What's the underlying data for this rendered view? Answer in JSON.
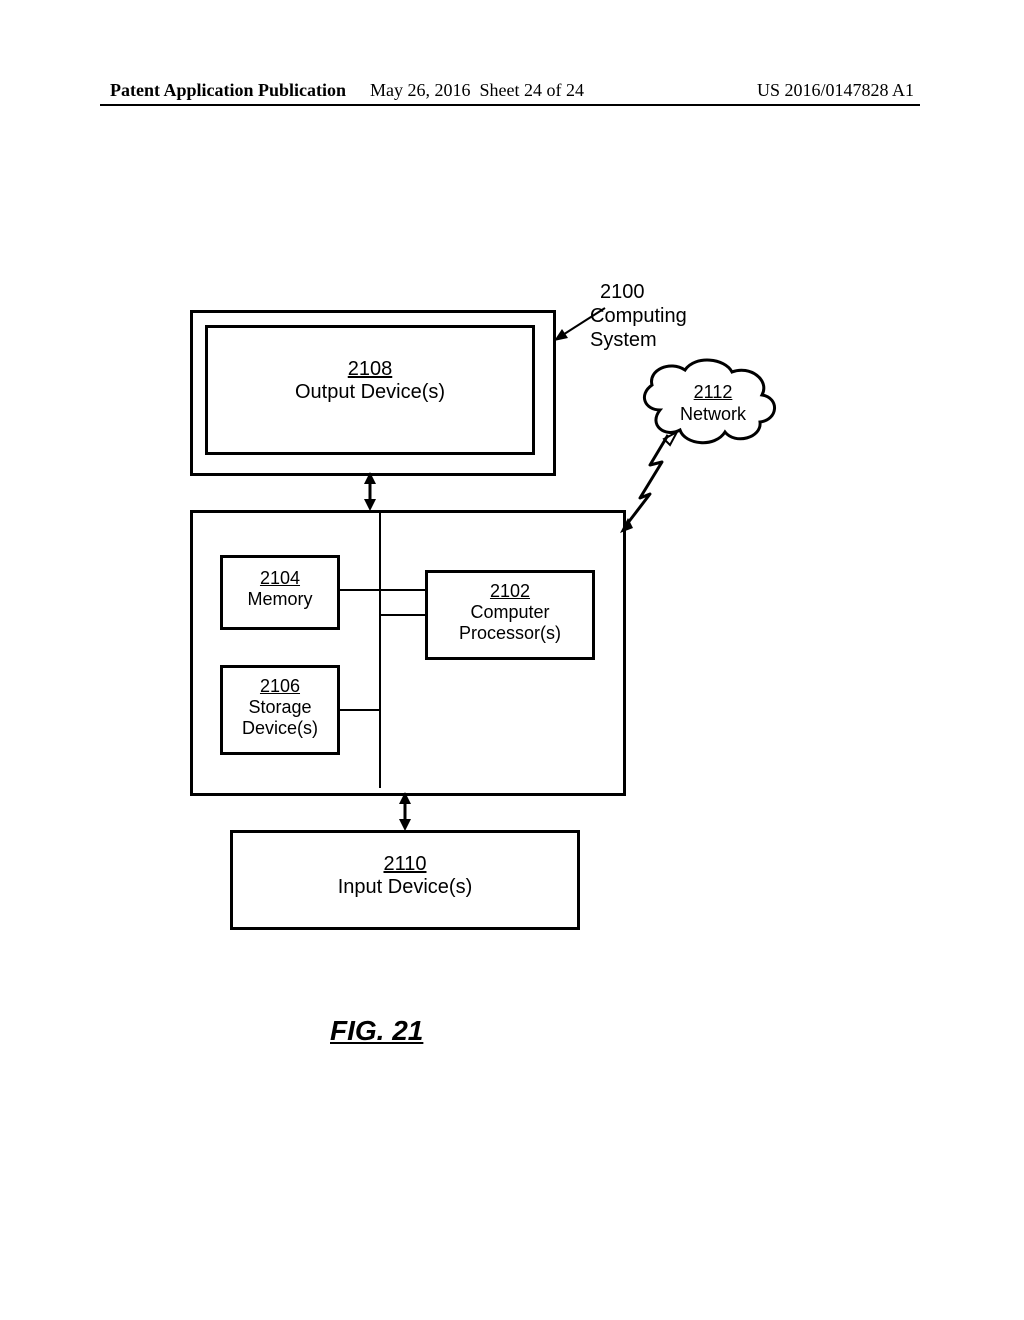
{
  "header": {
    "left": "Patent Application Publication",
    "mid_date": "May 26, 2016",
    "mid_sheet": "Sheet 24 of 24",
    "right": "US 2016/0147828 A1"
  },
  "system": {
    "num": "2100",
    "label_l1": "Computing",
    "label_l2": "System"
  },
  "output": {
    "num": "2108",
    "label": "Output Device(s)"
  },
  "memory": {
    "num": "2104",
    "label": "Memory"
  },
  "processor": {
    "num": "2102",
    "label_l1": "Computer",
    "label_l2": "Processor(s)"
  },
  "storage": {
    "num": "2106",
    "label_l1": "Storage",
    "label_l2": "Device(s)"
  },
  "input": {
    "num": "2110",
    "label": "Input Device(s)"
  },
  "network": {
    "num": "2112",
    "label": "Network"
  },
  "figure": "FIG. 21"
}
